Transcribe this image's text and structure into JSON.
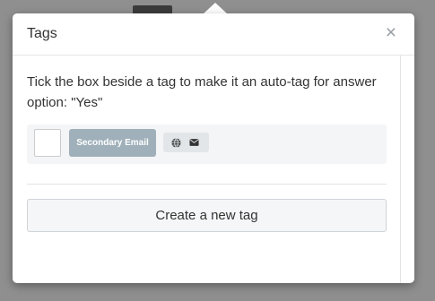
{
  "dialog": {
    "title": "Tags",
    "close_label": "×",
    "instructions": "Tick the box beside a tag to make it an auto-tag for answer option: \"Yes\""
  },
  "tags": [
    {
      "label": "Secondary Email",
      "checked": false,
      "color": "#9fb0ba",
      "icons": [
        "globe-icon",
        "envelope-icon"
      ]
    }
  ],
  "actions": {
    "create_label": "Create a new tag"
  }
}
